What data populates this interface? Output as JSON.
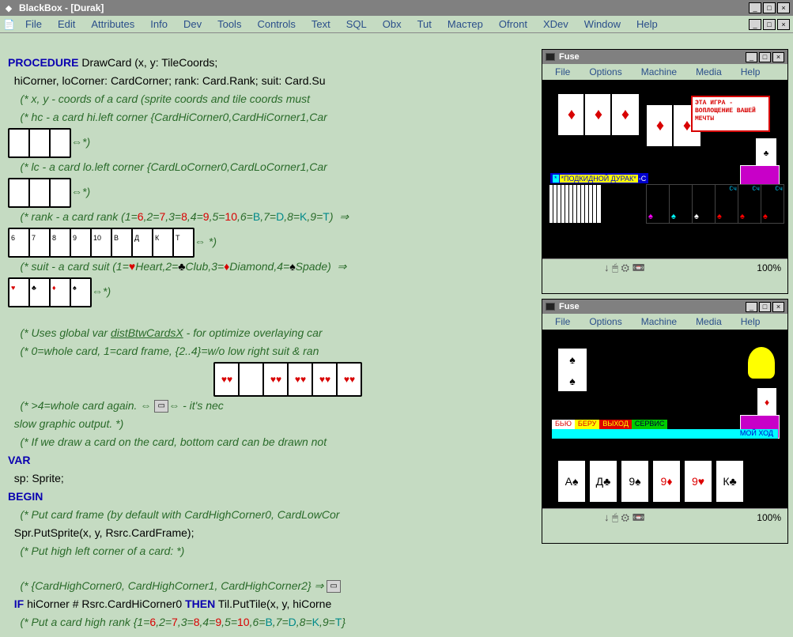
{
  "title": "BlackBox - [Durak]",
  "winbtns": {
    "min": "_",
    "max": "□",
    "close": "×"
  },
  "menu": [
    "File",
    "Edit",
    "Attributes",
    "Info",
    "Dev",
    "Tools",
    "Controls",
    "Text",
    "SQL",
    "Obx",
    "Tut",
    "Мастер",
    "Ofront",
    "XDev",
    "Window",
    "Help"
  ],
  "code": {
    "l1a": "PROCEDURE",
    "l1b": " DrawCard (x, y: TileCoords;",
    "l2": "  hiCorner, loCorner: CardCorner; rank: Card.Rank; suit: Card.Su",
    "c1": "    (* x, y - coords of a card (sprite coords and tile coords must",
    "c2": "    (* hc - a card hi.left corner {CardHiCorner0,CardHiCorner1,Car",
    "c2b": "⇔*)",
    "c3": "    (* lc - a card lo.left corner {CardLoCorner0,CardLoCorner1,Car",
    "c3b": "⇔*)",
    "c4a": "    (* rank - a card rank (1=",
    "c4_6": "6",
    "c4b": ",2=",
    "c4_7": "7",
    "c4c": ",3=",
    "c4_8": "8",
    "c4d": ",4=",
    "c4_9": "9",
    "c4e": ",5=",
    "c4_10": "10",
    "c4f": ",6=",
    "c4_B": "B",
    "c4g": ",7=",
    "c4_D": "D",
    "c4h": ",8=",
    "c4_K": "K",
    "c4i": ",9=",
    "c4_T": "T",
    "c4j": ")  ⇒",
    "c4k": "⇔ *)",
    "c5a": "    (* suit - a card suit (1=",
    "c5h": "♥",
    "c5ha": "Heart",
    "c5b": ",2=",
    "c5c": "♣",
    "c5ca": "Club",
    "c5d": ",3=",
    "c5di": "♦",
    "c5da": "Diamond",
    "c5e": ",4=",
    "c5s": "♠",
    "c5sa": "Spade",
    "c5f": ")  ⇒",
    "c5g": "⇔*)",
    "c6": "    (* Uses global var ",
    "c6u": "distBtwCardsX",
    "c6b": " - for optimize overlaying car",
    "c7": "    (* 0=whole card, 1=card frame, {2..4}=w/o low right suit & ran",
    "c8a": "    (* >4=whole card again. ⇔ ",
    "c8b": "⇔ - it's nec",
    "c9": "  slow graphic output. *)",
    "c10": "    (* If we draw a card on the card, bottom card can be drawn not",
    "var": "VAR",
    "sp": "  sp: Sprite;",
    "begin": "BEGIN",
    "c11": "    (* Put card frame (by default with CardHighCorner0, CardLowCor",
    "l11": "  Spr.PutSprite(x, y, Rsrc.CardFrame);",
    "c12": "    (* Put high left corner of a card: *)",
    "c13": "    (* {CardHighCorner0, CardHighCorner1, CardHighCorner2} ⇒ ",
    "l13a": "  ",
    "l13if": "IF",
    "l13b": " hiCorner # Rsrc.CardHiCorner0 ",
    "l13then": "THEN",
    "l13c": " Til.PutTile(x, y, hiCorne",
    "c14a": "    (* Put a card high rank {1=",
    "c14_6": "6",
    "c14b": ",2=",
    "c14_7": "7",
    "c14c": ",3=",
    "c14_8": "8",
    "c14d": ",4=",
    "c14_9": "9",
    "c14e": ",5=",
    "c14_10": "10",
    "c14f": ",6=",
    "c14_B": "B",
    "c14g": ",7=",
    "c14_D": "D",
    "c14h": ",8=",
    "c14_K": "K",
    "c14i": ",9=",
    "c14_T": "T",
    "c14j": "}",
    "ranklabels": [
      "6",
      "7",
      "8",
      "9",
      "10",
      "В",
      "Д",
      "К",
      "Т"
    ],
    "suitlabels": [
      "♥",
      "♣",
      "♦",
      "♠"
    ]
  },
  "fuse": {
    "title": "Fuse",
    "menu": [
      "File",
      "Options",
      "Machine",
      "Media",
      "Help"
    ],
    "zoom": "100%",
    "barText": "*ПОДКИДНОЙ ДУРАК*",
    "bubble": "ЭТА ИГРА -\nВОПЛОЩЕНИЕ\nВАШЕЙ МЕЧТЫ",
    "hand_cu": "Cч",
    "s2_bar1": {
      "byu": "БЬЮ",
      "beru": "БЕРУ",
      "vyhod": "ВЫХОД",
      "servis": "СЕРВИС"
    },
    "s2_bar2": "МОЙ  ХОД",
    "s2_cards": [
      "A♠",
      "Д♣",
      "9♠",
      "9♦",
      "9♥",
      "К♣"
    ]
  }
}
